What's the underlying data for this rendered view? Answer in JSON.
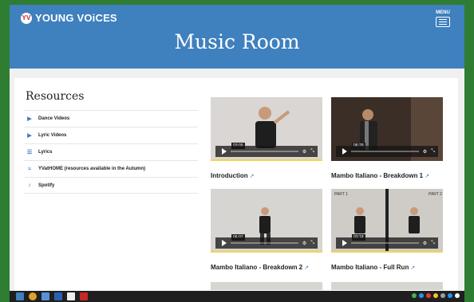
{
  "header": {
    "logo_text": "YOUNG VOiCES",
    "logo_badge": "YV",
    "menu_label": "MENU",
    "title": "Music Room"
  },
  "resources": {
    "title": "Resources",
    "items": [
      {
        "label": "Dance Videos",
        "icon": "video-icon"
      },
      {
        "label": "Lyric Videos",
        "icon": "video-icon"
      },
      {
        "label": "Lyrics",
        "icon": "document-icon"
      },
      {
        "label": "YVatHOME (resources available in the Autumn)",
        "icon": "wifi-icon"
      },
      {
        "label": "Spotify",
        "icon": "music-note-icon"
      }
    ]
  },
  "videos": [
    {
      "title": "Introduction",
      "time": "03:09",
      "bg": "#d9d6d3"
    },
    {
      "title": "Mambo Italiano - Breakdown 1",
      "time": "06:29",
      "bg": "#4a3a30"
    },
    {
      "title": "Mambo Italiano - Breakdown 2",
      "time": "06:07",
      "bg": "#d7d5d1"
    },
    {
      "title": "Mambo Italiano - Full Run",
      "time": "03:18",
      "bg": "#cfccc8",
      "labels": [
        "PART 1",
        "PART 2"
      ]
    }
  ],
  "colors": {
    "brand_blue": "#3f80be",
    "background_green": "#2e7d32"
  }
}
